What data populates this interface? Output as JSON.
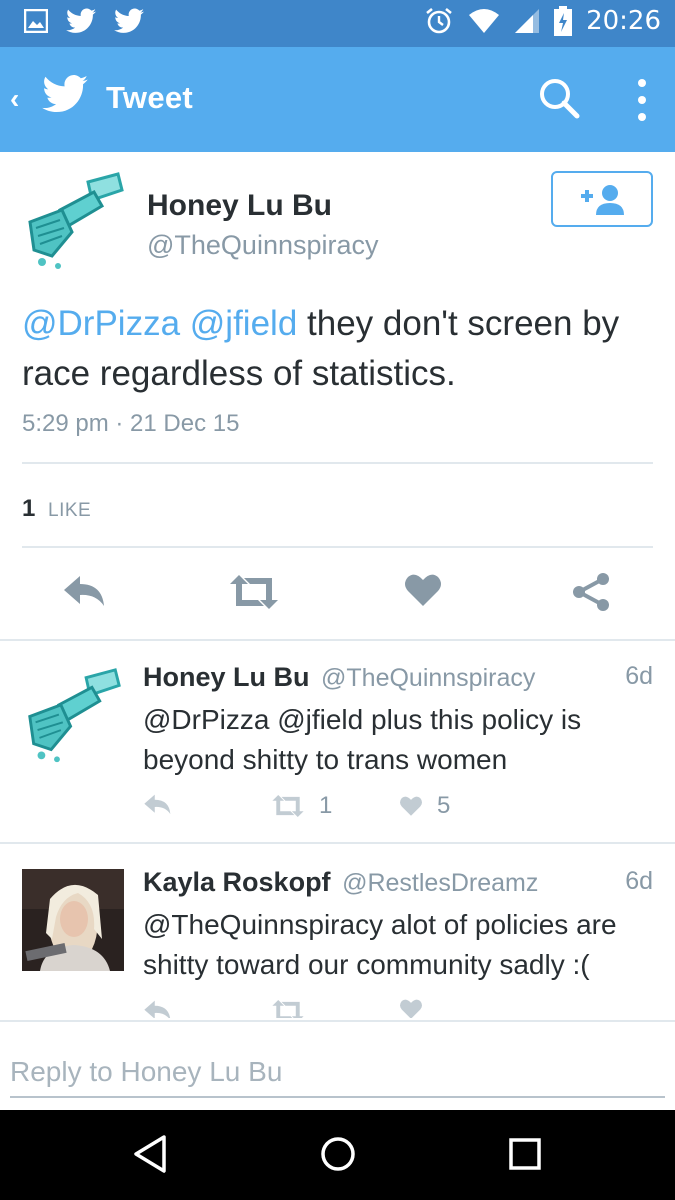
{
  "status_bar": {
    "time": "20:26",
    "left_icons": [
      "image-icon",
      "twitter-bird-icon",
      "twitter-bird-icon"
    ],
    "right_icons": [
      "alarm-icon",
      "wifi-icon",
      "signal-icon",
      "battery-charging-icon"
    ]
  },
  "app_bar": {
    "title": "Tweet",
    "back_glyph": "‹",
    "icons": [
      "back-chevron-icon",
      "twitter-bird-icon",
      "search-icon",
      "overflow-menu-icon"
    ]
  },
  "tweet": {
    "author_name": "Honey Lu Bu",
    "author_handle": "@TheQuinnspiracy",
    "mention_1": "@DrPizza",
    "mention_2": "@jfield",
    "body": "they don't screen by race regardless of statistics.",
    "timestamp": "5:29 pm · 21 Dec 15",
    "like_count": "1",
    "like_label": "LIKE",
    "follow_button_icon": "add-user-icon"
  },
  "replies": [
    {
      "author_name": "Honey Lu Bu",
      "author_handle": "@TheQuinnspiracy",
      "age": "6d",
      "text": "@DrPizza @jfield plus this policy is beyond shitty to trans women",
      "retweet_count": "1",
      "like_count": "5"
    },
    {
      "author_name": "Kayla Roskopf",
      "author_handle": "@RestlesDreamz",
      "age": "6d",
      "text": "@TheQuinnspiracy alot of policies are shitty toward our community sadly :(",
      "retweet_count": "",
      "like_count": ""
    }
  ],
  "composer": {
    "placeholder": "Reply to Honey Lu Bu"
  },
  "colors": {
    "status_bar": "#3f86c9",
    "app_bar": "#55acee",
    "link": "#55acee",
    "text": "#292f33",
    "muted": "#8899a6",
    "avatar_paint": "#4fc3c3"
  }
}
